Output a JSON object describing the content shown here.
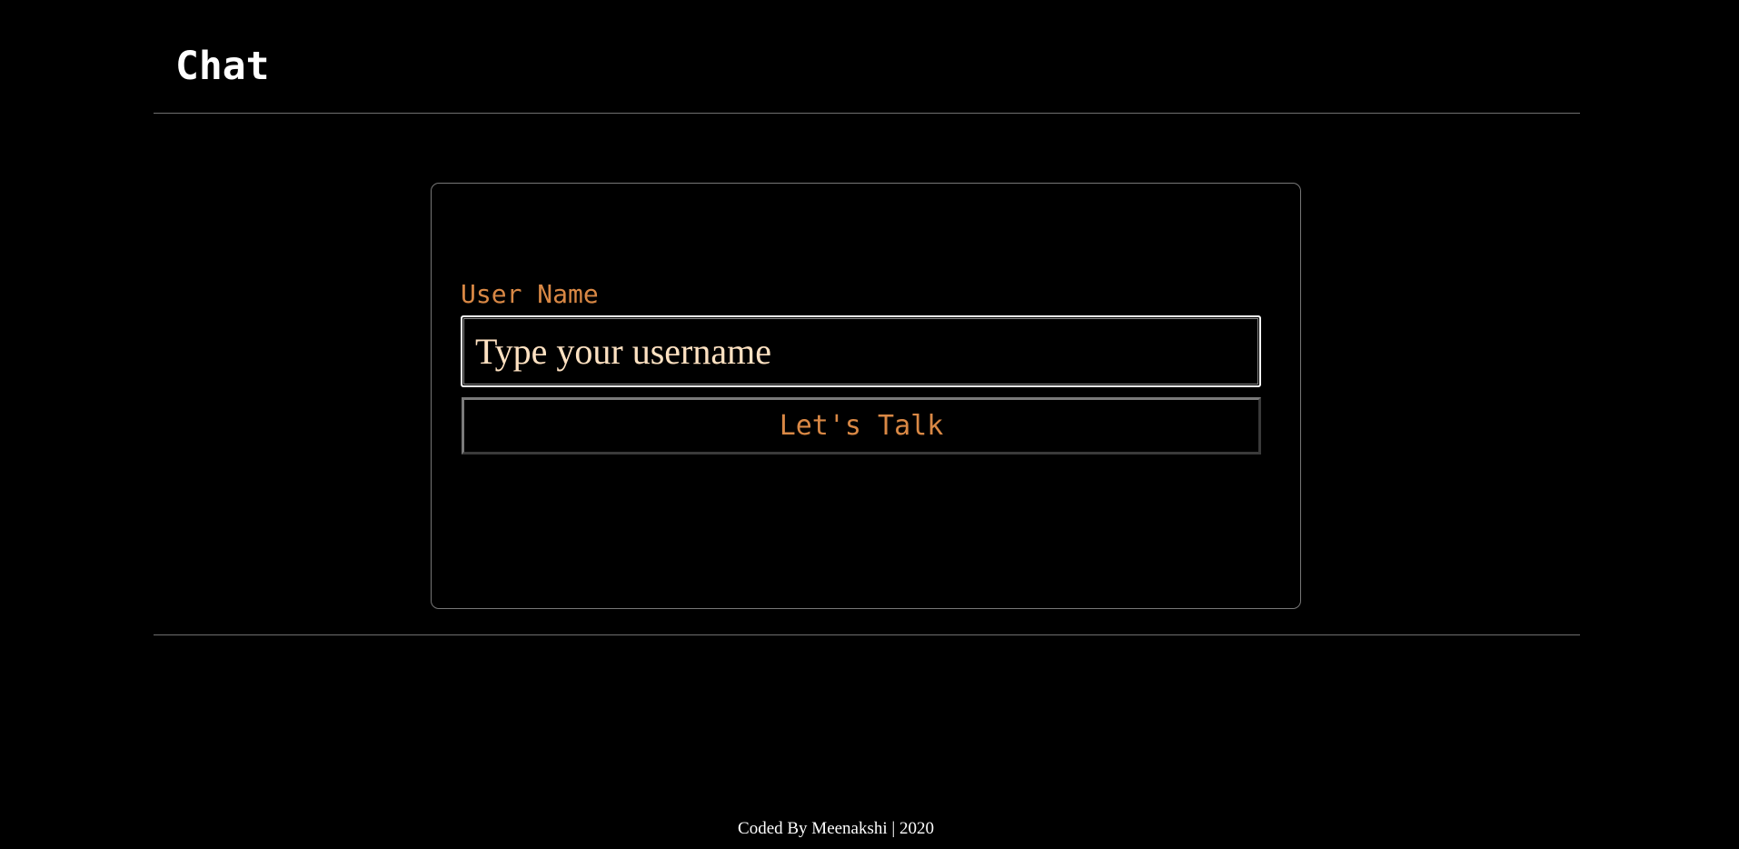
{
  "header": {
    "title": "Chat"
  },
  "login": {
    "label": "User Name",
    "input_value": "",
    "input_placeholder": "Type your username",
    "button_label": "Let's Talk"
  },
  "footer": {
    "text": "Coded By Meenakshi | 2020"
  },
  "colors": {
    "background": "#000000",
    "accent": "#d98845",
    "input_text": "#ffe2c2",
    "divider": "#6f6f6f"
  }
}
